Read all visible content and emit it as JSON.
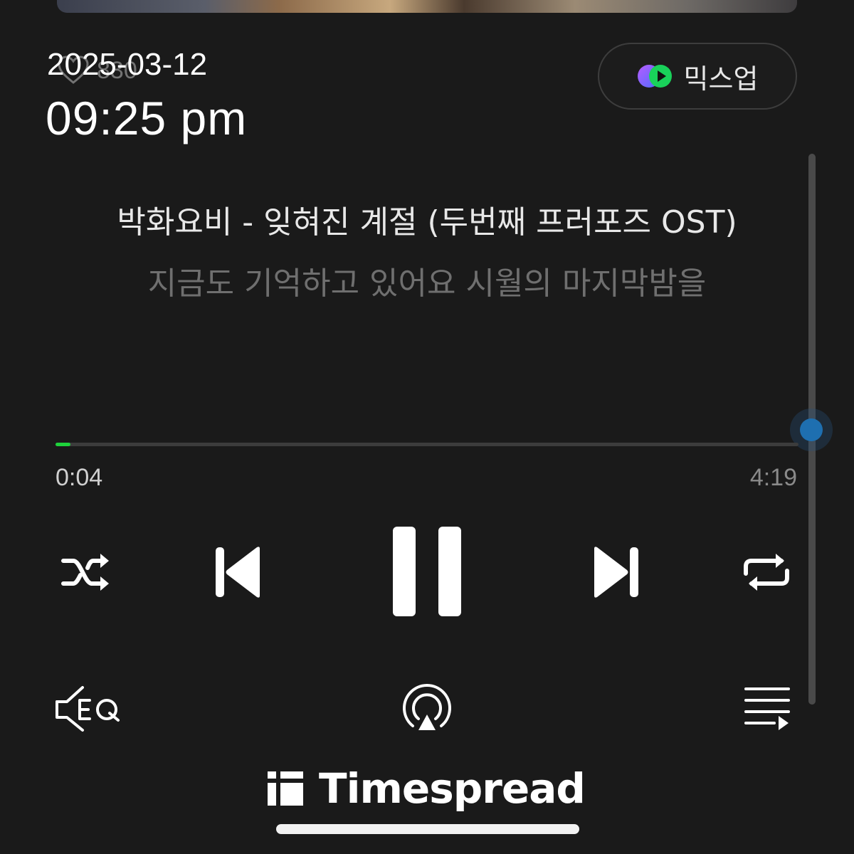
{
  "overlay": {
    "date": "2025-03-12",
    "time": "09:25 pm"
  },
  "header": {
    "likes_count": "830",
    "mixup_label": "믹스업"
  },
  "track": {
    "title": "박화요비 - 잊혀진 계절 (두번째 프러포즈 OST)",
    "lyric": "지금도 기억하고 있어요 시월의 마지막밤을",
    "elapsed": "0:04",
    "duration": "4:19",
    "progress": 0.02
  },
  "controls": {
    "shuffle_icon": "shuffle-icon",
    "previous_icon": "skip-previous-icon",
    "play_state": "playing",
    "pause_icon": "pause-icon",
    "next_icon": "skip-next-icon",
    "repeat_icon": "repeat-icon"
  },
  "bottom_bar": {
    "eq_icon": "equalizer-eq-icon",
    "airplay_icon": "airplay-icon",
    "queue_icon": "playlist-queue-icon"
  },
  "watermark": {
    "brand": "Timespread"
  },
  "colors": {
    "background": "#1a1a1a",
    "progress_accent": "#1ed23b",
    "scroll_thumb": "#1e6fb0",
    "lyric_dim": "#6f6f6f"
  }
}
